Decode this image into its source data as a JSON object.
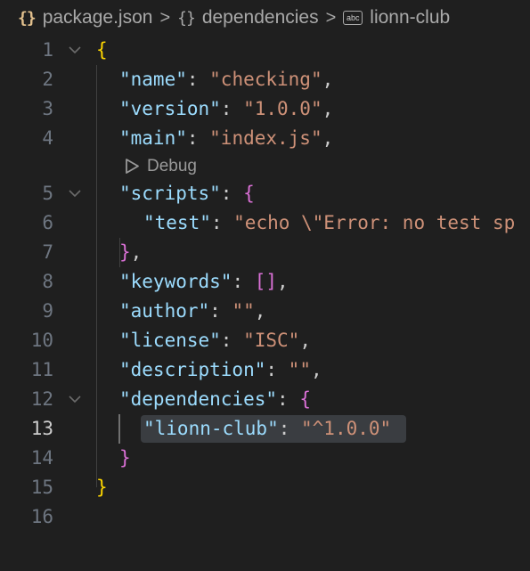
{
  "breadcrumb": {
    "file": "package.json",
    "section": "dependencies",
    "item": "lionn-club",
    "braces_glyph": "{}",
    "abc_glyph": "abc",
    "separator": ">"
  },
  "code_lens": {
    "label": "Debug"
  },
  "lines": {
    "l1": {
      "num": "1",
      "open": "{"
    },
    "l2": {
      "num": "2",
      "key": "\"name\"",
      "colon": ": ",
      "value": "\"checking\"",
      "tail": ","
    },
    "l3": {
      "num": "3",
      "key": "\"version\"",
      "colon": ": ",
      "value": "\"1.0.0\"",
      "tail": ","
    },
    "l4": {
      "num": "4",
      "key": "\"main\"",
      "colon": ": ",
      "value": "\"index.js\"",
      "tail": ","
    },
    "l5": {
      "num": "5",
      "key": "\"scripts\"",
      "colon": ": ",
      "open": "{"
    },
    "l6": {
      "num": "6",
      "key": "\"test\"",
      "colon": ": ",
      "value": "\"echo \\\"Error: no test sp"
    },
    "l7": {
      "num": "7",
      "close": "}",
      "tail": ","
    },
    "l8": {
      "num": "8",
      "key": "\"keywords\"",
      "colon": ": ",
      "value": "[]",
      "tail": ","
    },
    "l9": {
      "num": "9",
      "key": "\"author\"",
      "colon": ": ",
      "value": "\"\"",
      "tail": ","
    },
    "l10": {
      "num": "10",
      "key": "\"license\"",
      "colon": ": ",
      "value": "\"ISC\"",
      "tail": ","
    },
    "l11": {
      "num": "11",
      "key": "\"description\"",
      "colon": ": ",
      "value": "\"\"",
      "tail": ","
    },
    "l12": {
      "num": "12",
      "key": "\"dependencies\"",
      "colon": ": ",
      "open": "{"
    },
    "l13": {
      "num": "13",
      "key": "\"lionn-club\"",
      "colon": ": ",
      "value": "\"^1.0.0\""
    },
    "l14": {
      "num": "14",
      "close": "}"
    },
    "l15": {
      "num": "15",
      "close": "}"
    },
    "l16": {
      "num": "16"
    }
  },
  "colors": {
    "background": "#1f1f1f",
    "key": "#9cdcfe",
    "string": "#ce9178",
    "bracket_level1": "#ffd700",
    "bracket_level2": "#da70d6",
    "line_number": "#6e7681",
    "selection": "#3a3d41"
  }
}
